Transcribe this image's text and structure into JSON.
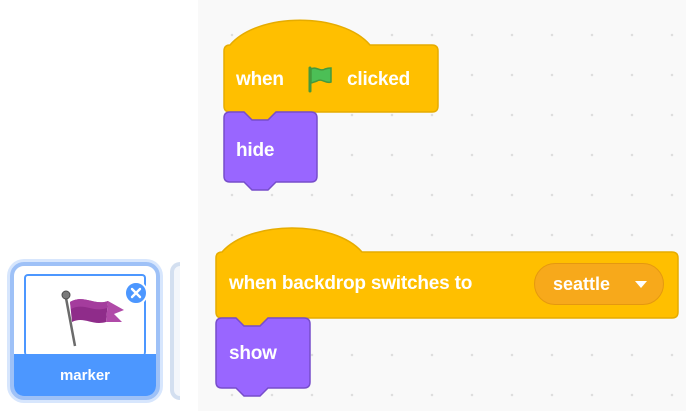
{
  "script1": {
    "hat_prefix": "when",
    "hat_suffix": "clicked",
    "flag_icon": "green-flag-icon",
    "stack_block": "hide"
  },
  "script2": {
    "hat_label": "when backdrop switches to",
    "backdrop_value": "seattle",
    "stack_block": "show"
  },
  "sprite": {
    "name": "marker",
    "costume_icon": "purple-flag-pin-icon",
    "delete_icon": "close-icon"
  },
  "colors": {
    "events": "#ffbf00",
    "events_border": "#e6ac00",
    "looks": "#9966ff",
    "looks_border": "#774dcb",
    "sprite_selected": "#4c97ff"
  }
}
